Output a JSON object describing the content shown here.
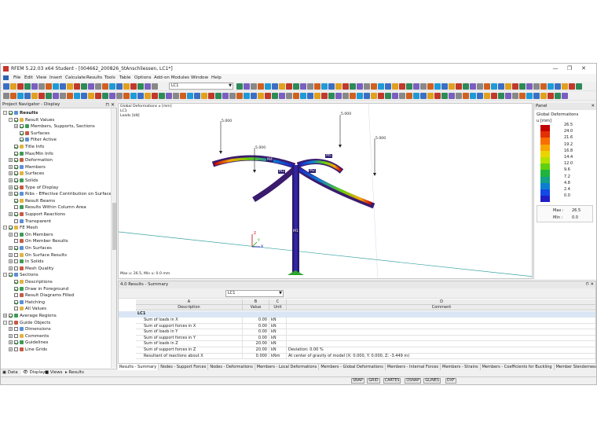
{
  "window": {
    "title": "RFEM 5.22.03 x64 Student - [004662_200826_StAnschliessen, LC1*]"
  },
  "menu": [
    "File",
    "Edit",
    "View",
    "Insert",
    "Calculate",
    "Results",
    "Tools",
    "Table",
    "Options",
    "Add-on Modules",
    "Window",
    "Help"
  ],
  "toolbar": {
    "load_case": "LC1",
    "results_load_case": "LC1"
  },
  "navigator": {
    "title": "Project Navigator - Display",
    "tree": [
      {
        "label": "Results",
        "level": 0,
        "exp": "-",
        "chk": true,
        "bold": true
      },
      {
        "label": "Result Values",
        "level": 1,
        "exp": "-",
        "chk": true
      },
      {
        "label": "Members, Supports, Sections",
        "level": 2,
        "exp": "+",
        "chk": true
      },
      {
        "label": "Surfaces",
        "level": 2,
        "exp": "",
        "chk": true
      },
      {
        "label": "Filter Active",
        "level": 2,
        "exp": "",
        "chk": true
      },
      {
        "label": "Title Info",
        "level": 1,
        "exp": "",
        "chk": true
      },
      {
        "label": "Max/Min Info",
        "level": 1,
        "exp": "",
        "chk": true
      },
      {
        "label": "Deformation",
        "level": 1,
        "exp": "+",
        "chk": true
      },
      {
        "label": "Members",
        "level": 1,
        "exp": "+",
        "chk": true
      },
      {
        "label": "Surfaces",
        "level": 1,
        "exp": "+",
        "chk": true
      },
      {
        "label": "Solids",
        "level": 1,
        "exp": "+",
        "chk": true
      },
      {
        "label": "Type of Display",
        "level": 1,
        "exp": "+",
        "chk": true
      },
      {
        "label": "Ribs - Effective Contribution on Surface/",
        "level": 1,
        "exp": "+",
        "chk": true
      },
      {
        "label": "Result Beams",
        "level": 1,
        "exp": "",
        "chk": true
      },
      {
        "label": "Results Within Column Area",
        "level": 1,
        "exp": "",
        "chk": false
      },
      {
        "label": "Support Reactions",
        "level": 1,
        "exp": "+",
        "chk": true
      },
      {
        "label": "Transparent",
        "level": 1,
        "exp": "",
        "chk": false
      },
      {
        "label": "FE Mesh",
        "level": 0,
        "exp": "-",
        "chk": true
      },
      {
        "label": "On Members",
        "level": 1,
        "exp": "+",
        "chk": false
      },
      {
        "label": "On Member Results",
        "level": 1,
        "exp": "",
        "chk": false
      },
      {
        "label": "On Surfaces",
        "level": 1,
        "exp": "+",
        "chk": true
      },
      {
        "label": "On Surface Results",
        "level": 1,
        "exp": "+",
        "chk": false
      },
      {
        "label": "In Solids",
        "level": 1,
        "exp": "+",
        "chk": false
      },
      {
        "label": "Mesh Quality",
        "level": 1,
        "exp": "+",
        "chk": false
      },
      {
        "label": "Sections",
        "level": 0,
        "exp": "-",
        "chk": true
      },
      {
        "label": "Descriptions",
        "level": 1,
        "exp": "",
        "chk": true
      },
      {
        "label": "Draw in Foreground",
        "level": 1,
        "exp": "",
        "chk": true
      },
      {
        "label": "Result Diagrams Filled",
        "level": 1,
        "exp": "",
        "chk": false
      },
      {
        "label": "Hatching",
        "level": 1,
        "exp": "",
        "chk": true
      },
      {
        "label": "All Values",
        "level": 1,
        "exp": "",
        "chk": false
      },
      {
        "label": "Average Regions",
        "level": 0,
        "exp": "+",
        "chk": true
      },
      {
        "label": "Guide Objects",
        "level": 0,
        "exp": "-",
        "chk": false
      },
      {
        "label": "Dimensions",
        "level": 1,
        "exp": "+",
        "chk": false
      },
      {
        "label": "Comments",
        "level": 1,
        "exp": "+",
        "chk": false
      },
      {
        "label": "Guidelines",
        "level": 1,
        "exp": "+",
        "chk": true
      },
      {
        "label": "Line Grids",
        "level": 1,
        "exp": "+",
        "chk": false
      }
    ],
    "tabs": [
      "Data",
      "Display",
      "Views",
      "Results"
    ]
  },
  "view": {
    "title_lines": [
      "Global Deformations u [mm]",
      "LC1",
      "Loads [kN]"
    ],
    "maxmin": "Max u: 26.5, Min u: 0.0 mm",
    "loads": [
      "5.000",
      "5.000",
      "5.000",
      "5.000",
      "5.000"
    ],
    "member_labels": [
      "M5",
      "M4",
      "M3",
      "M2",
      "M1"
    ],
    "axes": [
      "X",
      "Y",
      "Z"
    ]
  },
  "panel": {
    "title": "Panel",
    "heading": "Global Deformations",
    "unit": "u [mm]",
    "legend": [
      {
        "value": "26.5",
        "color": "#c40000"
      },
      {
        "value": "24.0",
        "color": "#e23000"
      },
      {
        "value": "21.6",
        "color": "#f86e00"
      },
      {
        "value": "19.2",
        "color": "#f7a600"
      },
      {
        "value": "16.8",
        "color": "#ead500"
      },
      {
        "value": "14.4",
        "color": "#b6e000"
      },
      {
        "value": "12.0",
        "color": "#62d00f"
      },
      {
        "value": "9.6",
        "color": "#1fb43b"
      },
      {
        "value": "7.2",
        "color": "#12a08a"
      },
      {
        "value": "4.8",
        "color": "#0b7ed2"
      },
      {
        "value": "2.4",
        "color": "#1449e6"
      },
      {
        "value": "0.0",
        "color": "#1f1ec6"
      }
    ],
    "max_label": "Max :",
    "max": "26.5",
    "min_label": "Min :",
    "min": "0.0"
  },
  "results": {
    "title": "4.0 Results - Summary",
    "col_letters": [
      "A",
      "B",
      "C",
      "D"
    ],
    "col_heads": [
      "Description",
      "Value",
      "Unit",
      "Comment"
    ],
    "group": "LC1",
    "rows": [
      {
        "d": "Sum of loads in X",
        "v": "0.00",
        "u": "kN",
        "c": ""
      },
      {
        "d": "Sum of support forces in X",
        "v": "0.00",
        "u": "kN",
        "c": ""
      },
      {
        "d": "Sum of loads in Y",
        "v": "0.00",
        "u": "kN",
        "c": ""
      },
      {
        "d": "Sum of support forces in Y",
        "v": "0.00",
        "u": "kN",
        "c": ""
      },
      {
        "d": "Sum of loads in Z",
        "v": "20.00",
        "u": "kN",
        "c": ""
      },
      {
        "d": "Sum of support forces in Z",
        "v": "20.00",
        "u": "kN",
        "c": "Deviation:  0.00 %"
      },
      {
        "d": "Resultant of reactions about X",
        "v": "0.000",
        "u": "kNm",
        "c": "At center of gravity of model (X: 0.000, Y: 0.000, Z: -3.449 m)"
      }
    ],
    "tabs": [
      "Results - Summary",
      "Nodes - Support Forces",
      "Nodes - Deformations",
      "Members - Local Deformations",
      "Members - Global Deformations",
      "Members - Internal Forces",
      "Members - Strains",
      "Members - Coefficients for Buckling",
      "Member Slendernesses"
    ]
  },
  "statusbar": [
    "SNAP",
    "GRID",
    "CARTES",
    "OSNAP",
    "GLINES",
    "DXF"
  ]
}
